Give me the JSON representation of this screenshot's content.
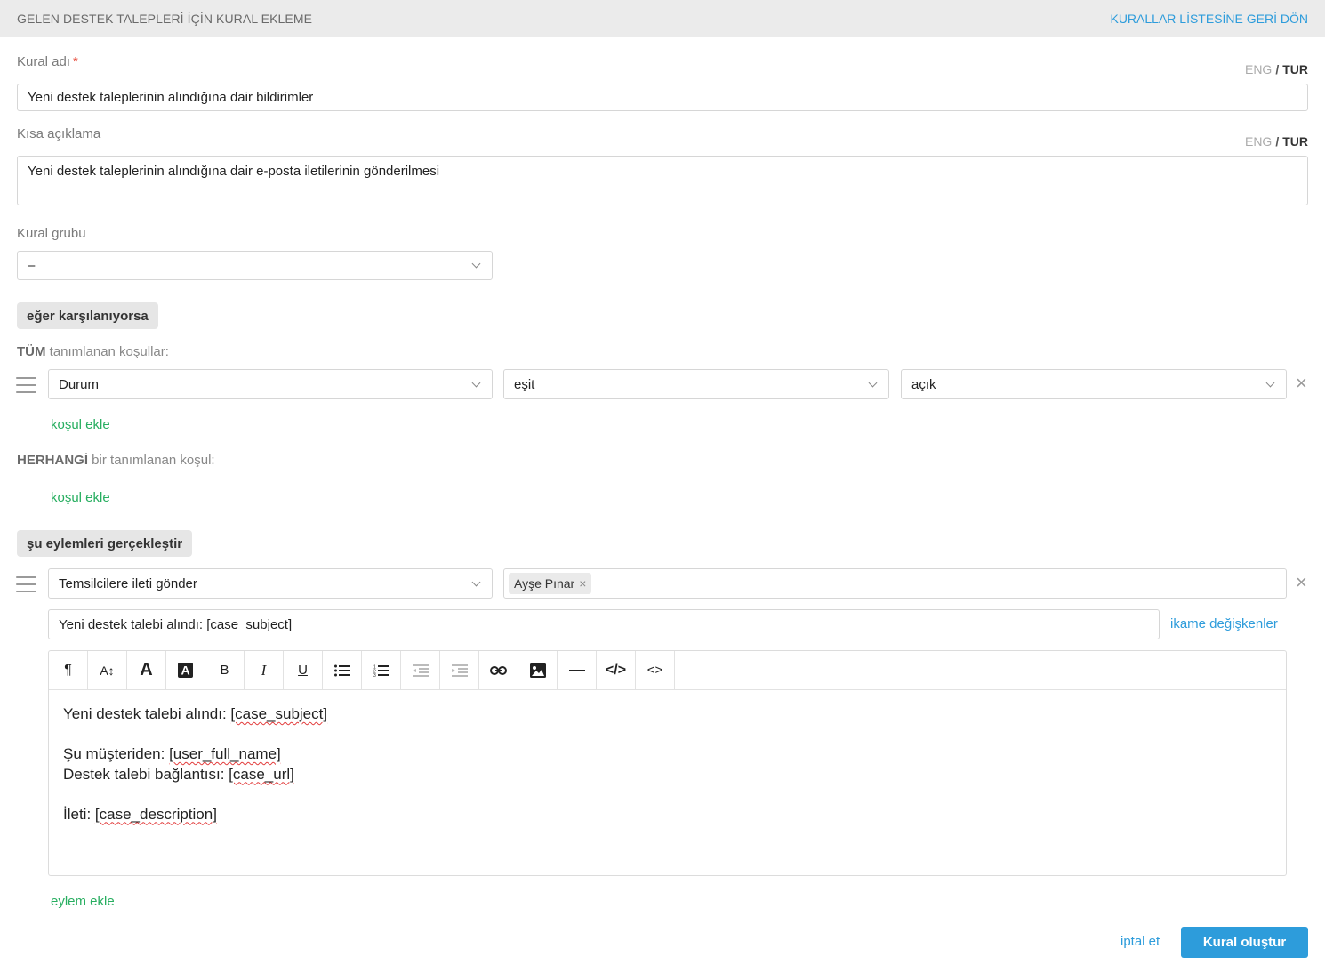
{
  "header": {
    "title": "GELEN DESTEK TALEPLERİ İÇİN KURAL EKLEME",
    "back_link": "KURALLAR LİSTESİNE GERİ DÖN"
  },
  "lang_switch": {
    "eng": "ENG",
    "sep": "/",
    "tur": "TUR"
  },
  "rule_name": {
    "label": "Kural adı",
    "required_mark": "*",
    "value": "Yeni destek taleplerinin alındığına dair bildirimler"
  },
  "short_desc": {
    "label": "Kısa açıklama",
    "value": "Yeni destek taleplerinin alındığına dair e-posta iletilerinin gönderilmesi"
  },
  "rule_group": {
    "label": "Kural grubu",
    "value": "–"
  },
  "conditions": {
    "pill": "eğer karşılanıyorsa",
    "all_bold": "TÜM",
    "all_rest": " tanımlanan koşullar:",
    "row": {
      "field": "Durum",
      "operator": "eşit",
      "value": "açık"
    },
    "add_all": "koşul ekle",
    "any_bold": "HERHANGİ",
    "any_rest": " bir tanımlanan koşul:",
    "add_any": "koşul ekle"
  },
  "actions": {
    "pill": "şu eylemleri gerçekleştir",
    "action": "Temsilcilere ileti gönder",
    "recipient_tag": "Ayşe Pınar",
    "tag_remove": "×",
    "subject": "Yeni destek talebi alındı: [case_subject]",
    "vars_link": "ikame değişkenler",
    "add_action": "eylem ekle"
  },
  "editor": {
    "l1_text": "Yeni destek talebi alındı: ",
    "l1_var": "[case_subject]",
    "l3_text": "Şu müşteriden: ",
    "l3_var": "[user_full_name]",
    "l4_text": "Destek talebi bağlantısı: ",
    "l4_var": "[case_url]",
    "l6_text": "İleti: ",
    "l6_var": "[case_description]"
  },
  "footer": {
    "cancel": "iptal et",
    "submit": "Kural oluştur"
  },
  "colors": {
    "accent": "#2d9cdb",
    "green": "#27ae60",
    "required": "#e74c3c"
  }
}
